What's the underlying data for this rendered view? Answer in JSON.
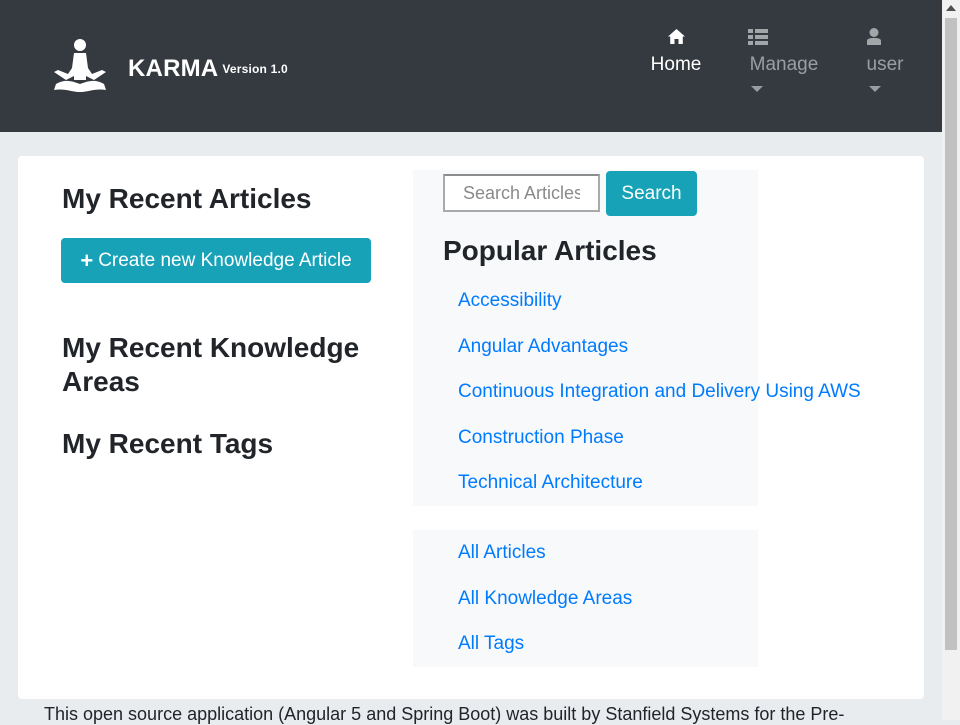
{
  "navbar": {
    "brand_name": "KARMA",
    "brand_version": "Version 1.0",
    "items": [
      {
        "label": "Home",
        "icon": "home-icon"
      },
      {
        "label": "Manage",
        "icon": "list-icon"
      },
      {
        "label": "user",
        "icon": "user-icon"
      }
    ]
  },
  "left": {
    "recent_articles_heading": "My Recent Articles",
    "create_button_label": "Create new Knowledge Article",
    "recent_areas_heading_line1": "My Recent Knowledge",
    "recent_areas_heading_line2": "Areas",
    "recent_tags_heading": "My Recent Tags"
  },
  "search": {
    "placeholder": "Search Articles",
    "button_label": "Search"
  },
  "popular": {
    "heading": "Popular Articles",
    "items": [
      "Accessibility",
      "Angular Advantages",
      "Continuous Integration and Delivery Using AWS",
      "Construction Phase",
      "Technical Architecture"
    ]
  },
  "all_links": [
    "All Articles",
    "All Knowledge Areas",
    "All Tags"
  ],
  "footer": {
    "text": "This open source application (Angular 5 and Spring Boot) was built by Stanfield Systems for the Pre-"
  },
  "colors": {
    "navbar": "#343a40",
    "accent": "#17a2b8",
    "link": "#007bff",
    "page_bg": "#e9ecef"
  }
}
